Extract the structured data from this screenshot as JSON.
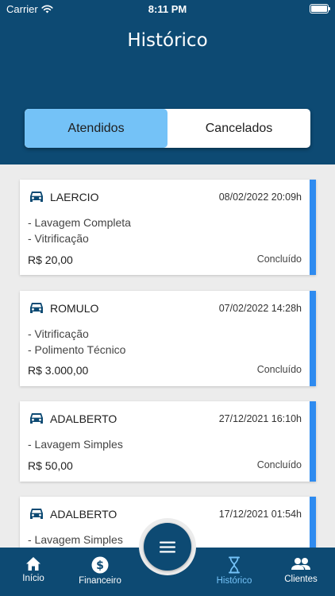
{
  "status_bar": {
    "carrier": "Carrier",
    "time": "8:11 PM"
  },
  "header": {
    "title": "Histórico"
  },
  "segments": {
    "attended": "Atendidos",
    "cancelled": "Cancelados",
    "active": "attended"
  },
  "records": [
    {
      "name": "LAERCIO",
      "datetime": "08/02/2022 20:09h",
      "services": [
        "- Lavagem Completa",
        "- Vitrificação"
      ],
      "price": "R$ 20,00",
      "status": "Concluído"
    },
    {
      "name": "ROMULO",
      "datetime": "07/02/2022 14:28h",
      "services": [
        "- Vitrificação",
        "- Polimento Técnico"
      ],
      "price": "R$ 3.000,00",
      "status": "Concluído"
    },
    {
      "name": "ADALBERTO",
      "datetime": "27/12/2021 16:10h",
      "services": [
        "- Lavagem Simples"
      ],
      "price": "R$ 50,00",
      "status": "Concluído"
    },
    {
      "name": "ADALBERTO",
      "datetime": "17/12/2021 01:54h",
      "services": [
        "- Lavagem Simples"
      ],
      "price": "",
      "status": ""
    }
  ],
  "tabbar": {
    "items": [
      {
        "label": "Início",
        "icon": "home-icon"
      },
      {
        "label": "Financeiro",
        "icon": "dollar-icon"
      },
      {
        "label": "Histórico",
        "icon": "hourglass-icon"
      },
      {
        "label": "Clientes",
        "icon": "people-icon"
      }
    ],
    "active_index": 2,
    "fab_icon": "menu-icon"
  },
  "colors": {
    "primary": "#0d4a73",
    "accent": "#2e8bf0",
    "segment_active": "#74c2f7",
    "background": "#ececec"
  }
}
